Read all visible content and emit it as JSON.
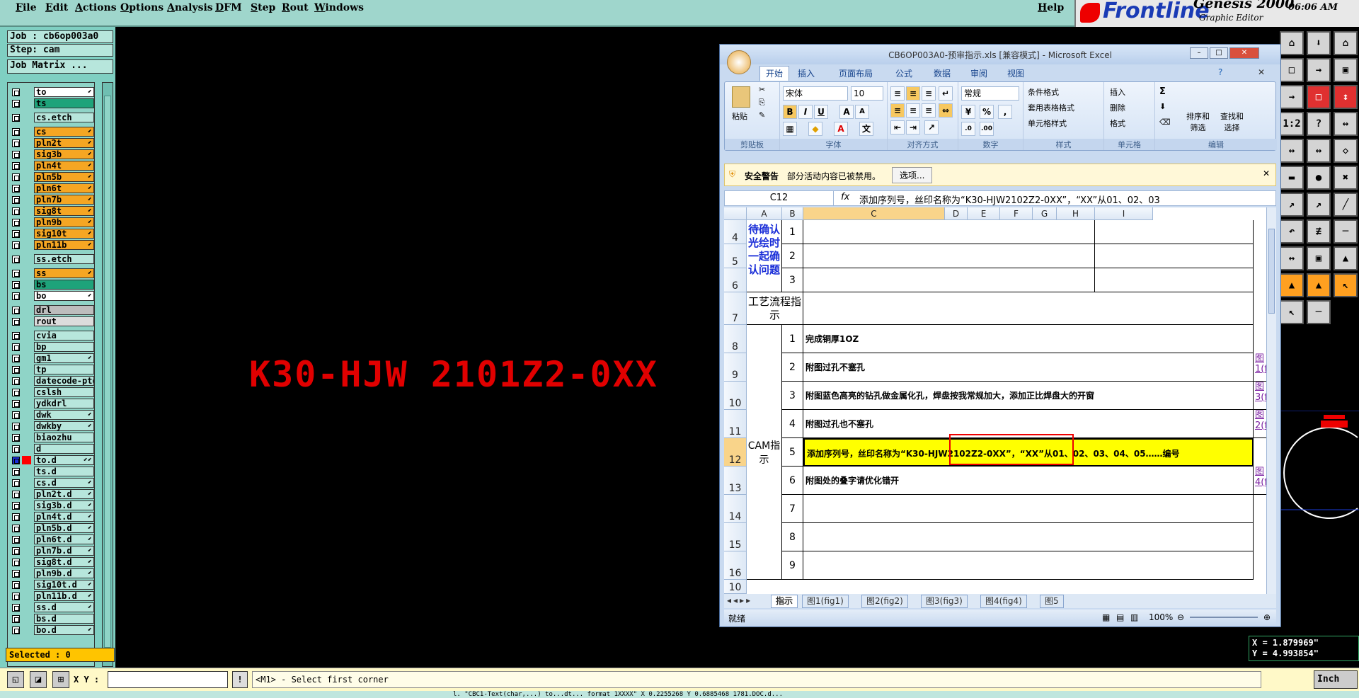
{
  "menu": {
    "items": [
      "File",
      "Edit",
      "Actions",
      "Options",
      "Analysis",
      "DFM",
      "Step",
      "Rout",
      "Windows"
    ],
    "help": "Help"
  },
  "logo": {
    "brand": "Frontline",
    "product": "Genesis 2000",
    "subtitle": "Graphic Editor",
    "clock": "06:06 AM"
  },
  "job": {
    "job_label": "Job : cb6op003a0",
    "step_label": "Step: cam",
    "matrix_button": "Job Matrix ..."
  },
  "layers": [
    {
      "name": "to",
      "color": "#ffffff",
      "arrow": "⬋",
      "highlighted": false
    },
    {
      "name": "ts",
      "color": "#1ea37a",
      "arrow": "",
      "highlighted": false
    },
    {
      "name": "cs.etch",
      "color": "#b7e6dc",
      "arrow": "",
      "highlighted": false
    },
    {
      "name": "cs",
      "color": "#f5a623",
      "arrow": "⬋",
      "highlighted": false
    },
    {
      "name": "pln2t",
      "color": "#f5a623",
      "arrow": "⬋",
      "highlighted": false
    },
    {
      "name": "sig3b",
      "color": "#f5a623",
      "arrow": "⬋",
      "highlighted": false
    },
    {
      "name": "pln4t",
      "color": "#f5a623",
      "arrow": "⬋",
      "highlighted": false
    },
    {
      "name": "pln5b",
      "color": "#f5a623",
      "arrow": "⬋",
      "highlighted": false
    },
    {
      "name": "pln6t",
      "color": "#f5a623",
      "arrow": "⬋",
      "highlighted": false
    },
    {
      "name": "pln7b",
      "color": "#f5a623",
      "arrow": "⬋",
      "highlighted": false
    },
    {
      "name": "sig8t",
      "color": "#f5a623",
      "arrow": "⬋",
      "highlighted": false
    },
    {
      "name": "pln9b",
      "color": "#f5a623",
      "arrow": "⬋",
      "highlighted": false
    },
    {
      "name": "sig10t",
      "color": "#f5a623",
      "arrow": "⬋",
      "highlighted": false
    },
    {
      "name": "pln11b",
      "color": "#f5a623",
      "arrow": "⬋",
      "highlighted": false
    },
    {
      "name": "ss.etch",
      "color": "#b7e6dc",
      "arrow": "",
      "highlighted": false
    },
    {
      "name": "ss",
      "color": "#f5a623",
      "arrow": "⬋",
      "highlighted": false
    },
    {
      "name": "bs",
      "color": "#1ea37a",
      "arrow": "",
      "highlighted": false
    },
    {
      "name": "bo",
      "color": "#ffffff",
      "arrow": "⬋",
      "highlighted": false
    },
    {
      "name": "drl",
      "color": "#bdbdbd",
      "arrow": "",
      "highlighted": false
    },
    {
      "name": "rout",
      "color": "#dcdcdc",
      "arrow": "",
      "highlighted": false
    },
    {
      "name": "cvia",
      "color": "#b7e6dc",
      "arrow": "",
      "highlighted": false
    },
    {
      "name": "bp",
      "color": "#b7e6dc",
      "arrow": "",
      "highlighted": false
    },
    {
      "name": "gm1",
      "color": "#b7e6dc",
      "arrow": "⬋",
      "highlighted": false
    },
    {
      "name": "tp",
      "color": "#b7e6dc",
      "arrow": "",
      "highlighted": false
    },
    {
      "name": "datecode-ptd",
      "color": "#b7e6dc",
      "arrow": "",
      "highlighted": false
    },
    {
      "name": "cslsh",
      "color": "#b7e6dc",
      "arrow": "",
      "highlighted": false
    },
    {
      "name": "ydkdrl",
      "color": "#b7e6dc",
      "arrow": "",
      "highlighted": false
    },
    {
      "name": "dwk",
      "color": "#b7e6dc",
      "arrow": "⬋",
      "highlighted": false
    },
    {
      "name": "dwkby",
      "color": "#b7e6dc",
      "arrow": "⬋",
      "highlighted": false
    },
    {
      "name": "biaozhu",
      "color": "#b7e6dc",
      "arrow": "",
      "highlighted": false
    },
    {
      "name": "d",
      "color": "#b7e6dc",
      "arrow": "",
      "highlighted": false
    },
    {
      "name": "to.d",
      "color": "#b7e6dc",
      "arrow": "⬋⬋",
      "highlighted": true
    },
    {
      "name": "ts.d",
      "color": "#b7e6dc",
      "arrow": "",
      "highlighted": false
    },
    {
      "name": "cs.d",
      "color": "#b7e6dc",
      "arrow": "⬋",
      "highlighted": false
    },
    {
      "name": "pln2t.d",
      "color": "#b7e6dc",
      "arrow": "⬋",
      "highlighted": false
    },
    {
      "name": "sig3b.d",
      "color": "#b7e6dc",
      "arrow": "⬋",
      "highlighted": false
    },
    {
      "name": "pln4t.d",
      "color": "#b7e6dc",
      "arrow": "⬋",
      "highlighted": false
    },
    {
      "name": "pln5b.d",
      "color": "#b7e6dc",
      "arrow": "⬋",
      "highlighted": false
    },
    {
      "name": "pln6t.d",
      "color": "#b7e6dc",
      "arrow": "⬋",
      "highlighted": false
    },
    {
      "name": "pln7b.d",
      "color": "#b7e6dc",
      "arrow": "⬋",
      "highlighted": false
    },
    {
      "name": "sig8t.d",
      "color": "#b7e6dc",
      "arrow": "⬋",
      "highlighted": false
    },
    {
      "name": "pln9b.d",
      "color": "#b7e6dc",
      "arrow": "⬋",
      "highlighted": false
    },
    {
      "name": "sig10t.d",
      "color": "#b7e6dc",
      "arrow": "⬋",
      "highlighted": false
    },
    {
      "name": "pln11b.d",
      "color": "#b7e6dc",
      "arrow": "⬋",
      "highlighted": false
    },
    {
      "name": "ss.d",
      "color": "#b7e6dc",
      "arrow": "⬋",
      "highlighted": false
    },
    {
      "name": "bs.d",
      "color": "#b7e6dc",
      "arrow": "",
      "highlighted": false
    },
    {
      "name": "bo.d",
      "color": "#b7e6dc",
      "arrow": "⬋",
      "highlighted": false
    }
  ],
  "selected_label": "Selected : 0",
  "canvas": {
    "text": "K30-HJW 2101Z2-0XX",
    "text_color": "#e00000"
  },
  "coords": {
    "x": "X = 1.879969\"",
    "y": "Y = 4.993854\""
  },
  "bottom": {
    "xy_label": "X Y :",
    "exclaim": "!",
    "prompt": "<M1> - Select first corner",
    "units": "Inch",
    "status": "l. \"CBC1-Text(char,...) to...dt... format 1XXXX\"  X 0.2255268 Y 0.6885468 1781.DOC.d..."
  },
  "right_tools": [
    "⌂",
    "⬇",
    "⌂",
    "□",
    "→",
    "▣",
    "→",
    "□",
    "↕",
    "1:2",
    "?",
    "↔",
    "↔",
    "↔",
    "◇",
    "▬",
    "●",
    "✖",
    "↗",
    "↗",
    "╱",
    "↶",
    "≢",
    "─",
    "↔",
    "▣",
    "▲",
    "▲",
    "▲",
    "↖",
    "↖",
    "─"
  ],
  "excel": {
    "title": "CB6OP003A0-预审指示.xls  [兼容模式] - Microsoft Excel",
    "tabs": [
      "开始",
      "插入",
      "页面布局",
      "公式",
      "数据",
      "审阅",
      "视图"
    ],
    "ribbon": {
      "clipboard": {
        "paste": "粘贴",
        "label": "剪贴板"
      },
      "font": {
        "name": "宋体",
        "size": "10",
        "label": "字体"
      },
      "align": {
        "label": "对齐方式"
      },
      "number": {
        "format": "常规",
        "label": "数字"
      },
      "styles": {
        "cond": "条件格式",
        "table": "套用表格格式",
        "cell": "单元格样式",
        "label": "样式"
      },
      "cells": {
        "insert": "插入",
        "delete": "删除",
        "format": "格式",
        "label": "单元格"
      },
      "edit": {
        "sort": "排序和\n筛选",
        "find": "查找和\n选择",
        "label": "编辑"
      }
    },
    "security": {
      "title": "安全警告",
      "message": "部分活动内容已被禁用。",
      "button": "选项..."
    },
    "name_box": "C12",
    "formula": "添加序列号，丝印名称为“K30-HJW2102Z2-0XX”，“XX”从01、02、03",
    "columns": [
      "A",
      "B",
      "C",
      "D",
      "E",
      "F",
      "G",
      "H",
      "I"
    ],
    "rows": {
      "confirm_label": "待确认光绘时一起确认问题",
      "process_label": "工艺流程指示",
      "cam_label": "CAM指示",
      "row_numbers": [
        "4",
        "5",
        "6",
        "7",
        "8",
        "9",
        "10",
        "11",
        "12",
        "13",
        "14",
        "15",
        "16",
        "10"
      ],
      "confirm_items": [
        "1",
        "2",
        "3"
      ],
      "cam_items": [
        {
          "n": "1",
          "text": "完成铜厚1OZ",
          "link": ""
        },
        {
          "n": "2",
          "text": "附图过孔不塞孔",
          "link": "图1(f"
        },
        {
          "n": "3",
          "text": "附图蓝色高亮的钻孔做金属化孔，焊盘按我常规加大，添加正比焊盘大的开窗",
          "link": "图3(f"
        },
        {
          "n": "4",
          "text": "附图过孔也不塞孔",
          "link": "图2(f"
        },
        {
          "n": "5",
          "text": "添加序列号，丝印名称为“K30-HJW2102Z2-0XX”，“XX”从01、02、03、04、05……编号",
          "link": ""
        },
        {
          "n": "6",
          "text": "附图处的叠字请优化错开",
          "link": "图4(f"
        },
        {
          "n": "7",
          "text": "",
          "link": ""
        },
        {
          "n": "8",
          "text": "",
          "link": ""
        },
        {
          "n": "9",
          "text": "",
          "link": ""
        }
      ]
    },
    "sheet_tabs": [
      "指示",
      "图1(fig1)",
      "图2(fig2)",
      "图3(fig3)",
      "图4(fig4)",
      "图5"
    ],
    "status": {
      "ready": "就绪",
      "zoom": "100%"
    }
  }
}
